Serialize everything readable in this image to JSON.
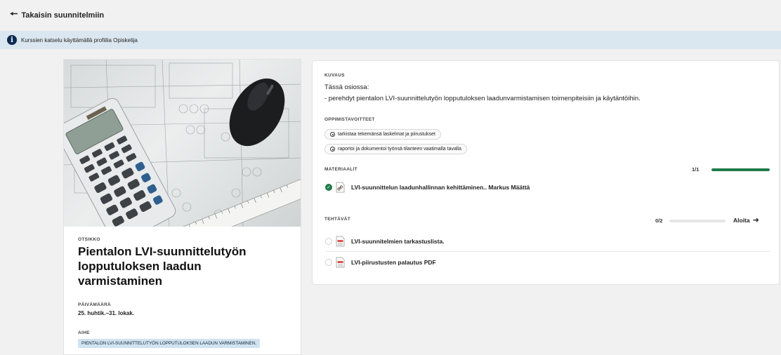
{
  "topbar": {
    "back_label": "Takaisin suunnitelmiin"
  },
  "info": {
    "text": "Kurssien katselu käyttämällä profiilia Opiskelija"
  },
  "course": {
    "title_label": "OTSIKKO",
    "title": "Pientalon LVI-suunnittelutyön lopputuloksen laadun varmistaminen",
    "date_label": "PÄIVÄMÄÄRÄ",
    "date": "25. huhtik.–31. lokak.",
    "topic_label": "AIHE",
    "topic": "PIENTALON LVI-SUUNNITTELUTYÖN LOPPUTULOKSEN LAADUN VARMISTAMINEN."
  },
  "description": {
    "label": "KUVAUS",
    "line1": "Tässä osiossa:",
    "line2": "- perehdyt pientalon LVI-suunnittelutyön lopputuloksen laadunvarmistamisen toimenpiteisiin ja käytäntöihin."
  },
  "objectives": {
    "label": "OPPIMISTAVOITTEET",
    "items": [
      "tarkistaa tekemänsä laskelmat ja piirustukset",
      "raportoi ja dokumentoi työnsä tilanteen vaatimalla tavalla"
    ]
  },
  "materials": {
    "label": "MATERIAALIT",
    "progress_text": "1/1",
    "progress": 1.0,
    "items": [
      "LVI-suunnittelun laadunhallinnan kehittäminen.. Markus Määttä"
    ]
  },
  "tasks": {
    "label": "TEHTÄVÄT",
    "progress_text": "0/2",
    "progress": 0.0,
    "start_label": "Aloita",
    "items": [
      "LVI-suunnitelmien tarkastuslista.",
      "LVI-piirustusten palautus PDF"
    ]
  },
  "colors": {
    "accent": "#1e7b4a",
    "info_bg": "#dbe7f0",
    "tag_bg": "#cfe3f1"
  }
}
